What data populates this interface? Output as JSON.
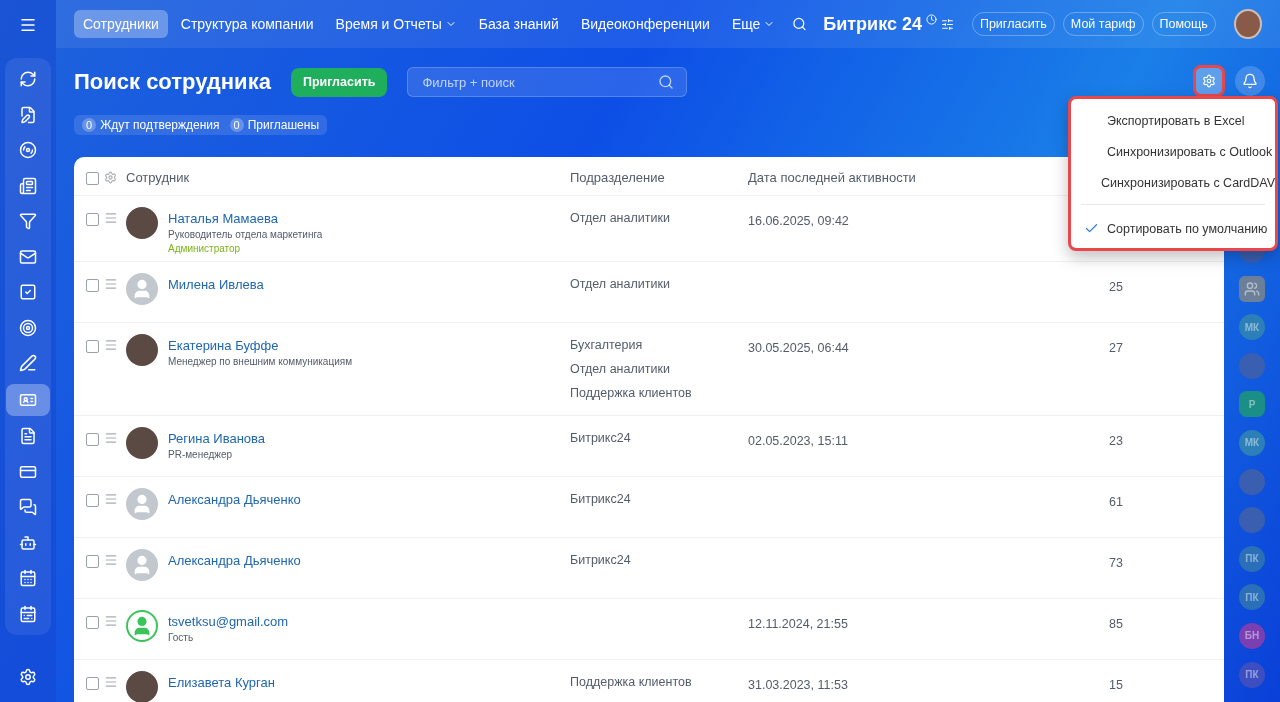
{
  "sidebar": {
    "items": [
      {
        "selected": false
      },
      {
        "selected": false
      },
      {
        "selected": false
      },
      {
        "selected": false
      },
      {
        "selected": false
      },
      {
        "selected": false
      },
      {
        "selected": false
      },
      {
        "selected": false
      },
      {
        "selected": false
      },
      {
        "selected": true
      },
      {
        "selected": false
      },
      {
        "selected": false
      },
      {
        "selected": false
      },
      {
        "selected": false
      },
      {
        "selected": false
      },
      {
        "selected": false
      }
    ]
  },
  "top_nav": {
    "tabs": [
      {
        "label": "Сотрудники",
        "selected": true,
        "has_menu": false
      },
      {
        "label": "Структура компании",
        "selected": false,
        "has_menu": false
      },
      {
        "label": "Время и Отчеты",
        "selected": false,
        "has_menu": true
      },
      {
        "label": "База знаний",
        "selected": false,
        "has_menu": false
      },
      {
        "label": "Видеоконференции",
        "selected": false,
        "has_menu": false
      },
      {
        "label": "Еще",
        "selected": false,
        "has_menu": true
      }
    ],
    "logo": "Битрикс 24",
    "buttons": [
      "Пригласить",
      "Мой тариф",
      "Помощь"
    ]
  },
  "page": {
    "title": "Поиск сотрудника",
    "invite_button": "Пригласить",
    "search": {
      "placeholder": "Фильтр + поиск"
    },
    "counters": [
      {
        "count": "0",
        "label": "Ждут подтверждения"
      },
      {
        "count": "0",
        "label": "Приглашены"
      }
    ]
  },
  "table": {
    "select_all_checked": false,
    "columns": [
      "Сотрудник",
      "Подразделение",
      "Дата последней активности"
    ],
    "rows": [
      {
        "kind": "photo",
        "name": "Наталья Мамаева",
        "position": "Руководитель отдела маркетинга",
        "role": "Администратор",
        "departments": [
          "Отдел аналитики"
        ],
        "last_activity": "16.06.2025, 09:42",
        "checked": false
      },
      {
        "kind": "placeholder",
        "name": "Милена Ивлева",
        "departments": [
          "Отдел аналитики"
        ],
        "column_4": "25",
        "checked": false
      },
      {
        "kind": "photo",
        "name": "Екатерина Буффе",
        "position": "Менеджер по внешним коммуникациям",
        "departments": [
          "Бухгалтерия",
          "Отдел аналитики",
          "Поддержка клиентов"
        ],
        "last_activity": "30.05.2025, 06:44",
        "column_4": "27",
        "checked": false
      },
      {
        "kind": "photo",
        "name": "Регина Иванова",
        "position": "PR-менеджер",
        "departments": [
          "Битрикс24"
        ],
        "last_activity": "02.05.2023, 15:11",
        "column_4": "23",
        "checked": false
      },
      {
        "kind": "placeholder",
        "name": "Александра Дьяченко",
        "departments": [
          "Битрикс24"
        ],
        "column_4": "61",
        "checked": false
      },
      {
        "kind": "placeholder",
        "name": "Александра Дьяченко",
        "departments": [
          "Битрикс24"
        ],
        "column_4": "73",
        "checked": false
      },
      {
        "kind": "guest",
        "name": "tsvetksu@gmail.com",
        "position": "Гость",
        "last_activity": "12.11.2024, 21:55",
        "column_4": "85",
        "checked": false
      },
      {
        "kind": "photo",
        "name": "Елизавета Курган",
        "departments": [
          "Поддержка клиентов"
        ],
        "last_activity": "31.03.2023, 11:53",
        "column_4": "15",
        "checked": false
      }
    ]
  },
  "settings_menu": {
    "items": [
      {
        "label": "Экспортировать в Excel",
        "checked": false
      },
      {
        "label": "Синхронизировать с Outlook",
        "checked": false
      },
      {
        "label": "Синхронизировать с CardDAV",
        "checked": false
      },
      {
        "label": "Сортировать по умолчанию",
        "checked": true
      }
    ]
  },
  "right_rail": {
    "items": [
      {
        "kind": "photo"
      },
      {
        "kind": "group"
      },
      {
        "kind": "initials",
        "text": "МК",
        "color": "#2d7fb8"
      },
      {
        "kind": "photo"
      },
      {
        "kind": "hexagon",
        "text": "Р",
        "color": "#1b8f86"
      },
      {
        "kind": "initials",
        "text": "МК",
        "color": "#2d7fb8"
      },
      {
        "kind": "photo"
      },
      {
        "kind": "photo"
      },
      {
        "kind": "initials",
        "text": "ПК",
        "color": "#2a6fb8"
      },
      {
        "kind": "initials",
        "text": "ПК",
        "color": "#2a6fb8"
      },
      {
        "kind": "initials",
        "text": "БН",
        "color": "#7a3fb0"
      },
      {
        "kind": "initials",
        "text": "ПК",
        "color": "#3d4fc0"
      }
    ]
  }
}
